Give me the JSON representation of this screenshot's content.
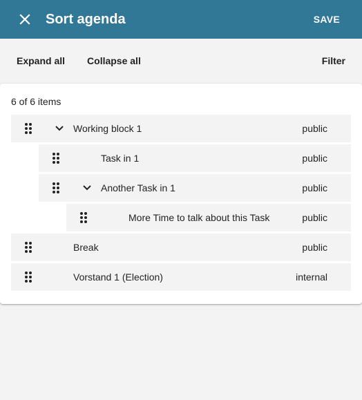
{
  "header": {
    "title": "Sort agenda",
    "save_label": "SAVE",
    "close_icon": "close-icon"
  },
  "toolbar": {
    "expand_label": "Expand all",
    "collapse_label": "Collapse all",
    "filter_label": "Filter"
  },
  "list": {
    "count_label": "6 of 6 items",
    "items": [
      {
        "title": "Working block 1",
        "visibility": "public",
        "level": 0,
        "expandable": true
      },
      {
        "title": "Task in 1",
        "visibility": "public",
        "level": 1,
        "expandable": false
      },
      {
        "title": "Another Task in 1",
        "visibility": "public",
        "level": 1,
        "expandable": true
      },
      {
        "title": "More Time to talk about this Task",
        "visibility": "public",
        "level": 2,
        "expandable": false
      },
      {
        "title": "Break",
        "visibility": "public",
        "level": 0,
        "expandable": false
      },
      {
        "title": "Vorstand 1 (Election)",
        "visibility": "internal",
        "level": 0,
        "expandable": false
      }
    ]
  },
  "colors": {
    "appbar": "#317796",
    "background": "#f3f3f3",
    "row": "#f3f3f3"
  }
}
